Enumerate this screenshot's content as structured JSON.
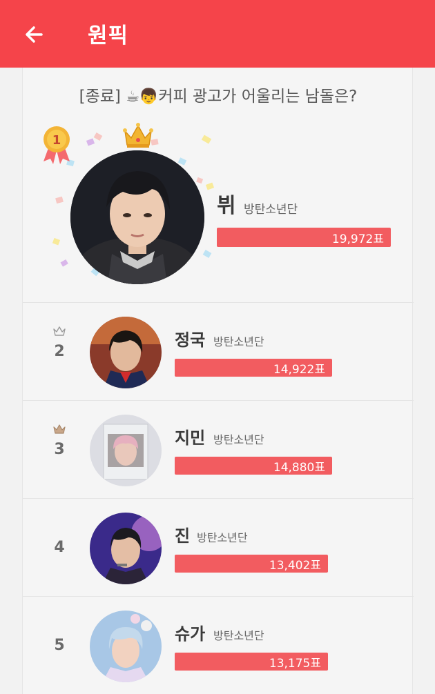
{
  "header": {
    "title": "원픽",
    "back_icon": "arrow-left-icon",
    "color": "#f5444a"
  },
  "poll": {
    "status": "[종료]",
    "emoji": "☕👦",
    "title": "커피 광고가 어울리는 남돌은?"
  },
  "accent": "#f25c60",
  "ranking": [
    {
      "rank": "1",
      "name": "뷔",
      "group": "방탄소년단",
      "votes": "19,972표",
      "bar_fraction": 1.0
    },
    {
      "rank": "2",
      "name": "정국",
      "group": "방탄소년단",
      "votes": "14,922표",
      "bar_fraction": 0.747
    },
    {
      "rank": "3",
      "name": "지민",
      "group": "방탄소년단",
      "votes": "14,880표",
      "bar_fraction": 0.745
    },
    {
      "rank": "4",
      "name": "진",
      "group": "방탄소년단",
      "votes": "13,402표",
      "bar_fraction": 0.671
    },
    {
      "rank": "5",
      "name": "슈가",
      "group": "방탄소년단",
      "votes": "13,175표",
      "bar_fraction": 0.66
    }
  ]
}
